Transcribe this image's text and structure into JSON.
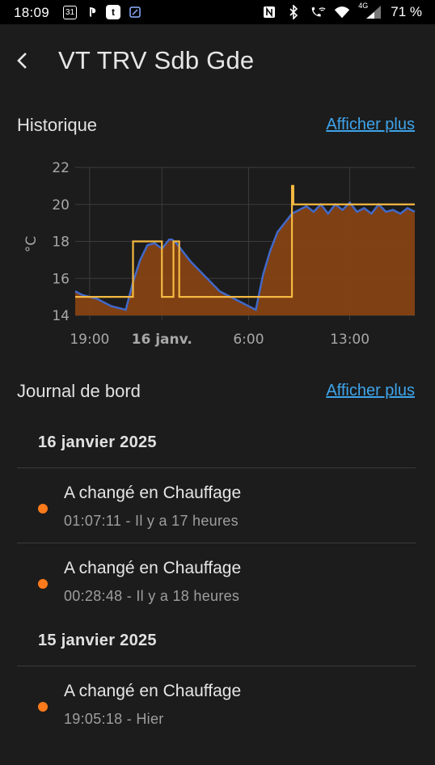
{
  "status_bar": {
    "time": "18:09",
    "calendar_day": "31",
    "battery": "71 %",
    "network": "4G"
  },
  "header": {
    "title": "VT TRV Sdb Gde"
  },
  "history": {
    "title": "Historique",
    "more_link": "Afficher plus"
  },
  "chart_data": {
    "type": "line",
    "ylabel": "°C",
    "ylim": [
      14,
      22
    ],
    "yticks": [
      "22",
      "20",
      "18",
      "16",
      "14"
    ],
    "xtick_labels": [
      "19:00",
      "16 janv.",
      "6:00",
      "13:00"
    ],
    "series": [
      {
        "kind": "current-temperature",
        "color": "#4169c9",
        "fill": "#8b4513",
        "x": [
          0,
          0.5,
          1,
          1.5,
          2,
          2.5,
          3,
          3.5,
          4,
          4.5,
          5,
          5.5,
          6,
          6.5,
          6.7,
          7,
          7.3,
          7.6,
          8,
          8.5,
          9,
          9.5,
          10,
          10.5,
          11,
          11.5,
          12,
          12.5,
          13,
          13.5,
          14,
          14.5,
          15,
          15.5,
          16,
          16.5,
          17,
          17.5,
          18,
          18.5,
          19,
          19.5,
          20,
          20.5,
          21,
          21.5,
          22,
          22.5,
          23,
          23.5
        ],
        "y": [
          15.3,
          15.1,
          15.0,
          14.9,
          14.7,
          14.5,
          14.4,
          14.3,
          15.8,
          17.0,
          17.8,
          17.9,
          17.6,
          18.1,
          18.1,
          17.9,
          17.6,
          17.3,
          16.9,
          16.5,
          16.1,
          15.7,
          15.3,
          15.1,
          14.9,
          14.7,
          14.5,
          14.3,
          16.2,
          17.5,
          18.5,
          19.0,
          19.5,
          19.7,
          19.9,
          19.6,
          20.0,
          19.5,
          20.0,
          19.7,
          20.1,
          19.6,
          19.8,
          19.5,
          20.0,
          19.6,
          19.7,
          19.5,
          19.8,
          19.6
        ]
      },
      {
        "kind": "target-temperature",
        "color": "#f5b942",
        "points": [
          [
            0,
            15
          ],
          [
            4,
            15
          ],
          [
            4,
            18
          ],
          [
            6,
            18
          ],
          [
            6,
            15
          ],
          [
            6.8,
            15
          ],
          [
            6.8,
            18
          ],
          [
            7.2,
            18
          ],
          [
            7.2,
            15
          ],
          [
            15,
            15
          ],
          [
            15,
            21
          ],
          [
            15.1,
            21
          ],
          [
            15.1,
            20
          ],
          [
            23.5,
            20
          ]
        ]
      }
    ],
    "x_domain_hours": [
      0,
      23.5
    ],
    "grid": true
  },
  "logbook": {
    "title": "Journal de bord",
    "more_link": "Afficher plus",
    "groups": [
      {
        "date": "16 janvier 2025",
        "entries": [
          {
            "message": "A changé en Chauffage",
            "meta": "01:07:11 - Il y a 17 heures"
          },
          {
            "message": "A changé en Chauffage",
            "meta": "00:28:48 - Il y a 18 heures"
          }
        ]
      },
      {
        "date": "15 janvier 2025",
        "entries": [
          {
            "message": "A changé en Chauffage",
            "meta": "19:05:18 - Hier"
          }
        ]
      }
    ]
  }
}
